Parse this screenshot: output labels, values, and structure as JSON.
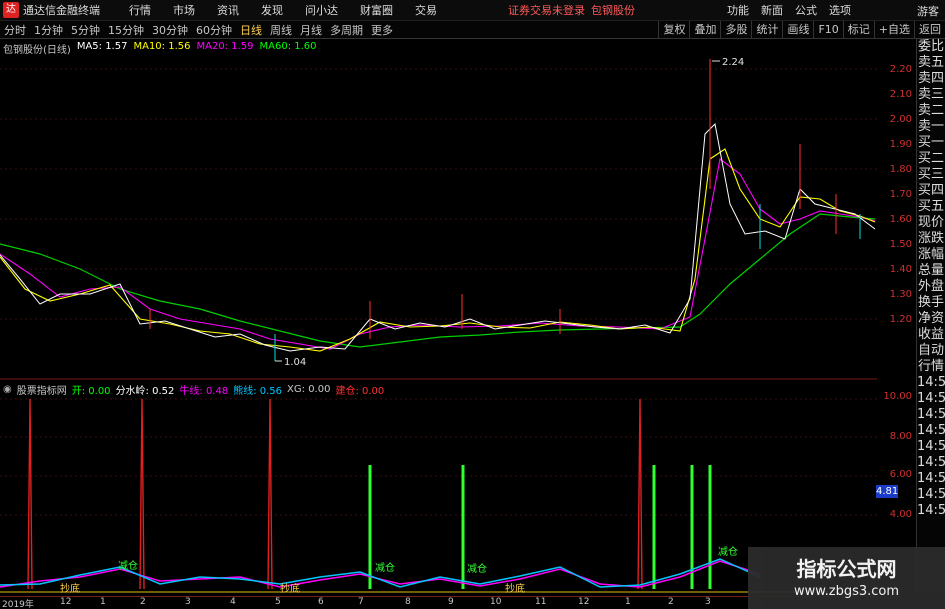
{
  "titlebar": {
    "app_title": "通达信金融终端",
    "menu": [
      "行情",
      "市场",
      "资讯",
      "发现",
      "问小达",
      "财富圈",
      "交易"
    ],
    "notice": "证券交易未登录",
    "notice_stock": "包钢股份",
    "right_menu": [
      "功能",
      "新面",
      "公式",
      "选项"
    ],
    "user": "游客"
  },
  "toolbar": {
    "periods": [
      "分时",
      "1分钟",
      "5分钟",
      "15分钟",
      "30分钟",
      "60分钟",
      "日线",
      "周线",
      "月线",
      "多周期",
      "更多"
    ],
    "active_period": "日线",
    "right_buttons": [
      "复权",
      "叠加",
      "多股",
      "统计",
      "画线",
      "F10",
      "标记",
      "+自选",
      "返回"
    ]
  },
  "main_chart": {
    "title": "包钢股份(日线)",
    "ma5": "MA5: 1.57",
    "ma10": "MA10: 1.56",
    "ma20": "MA20: 1.59",
    "ma60": "MA60: 1.60",
    "high_label": "2.24",
    "low_label": "1.04",
    "colors": {
      "ma5": "#ffffff",
      "ma10": "#ffff00",
      "ma20": "#ff00ff",
      "ma60": "#00ff00",
      "up": "#ff3030",
      "down": "#00e0e0"
    }
  },
  "sub_chart": {
    "title": "股票指标网",
    "l_kai": "开: 0.00",
    "l_fsl": "分水岭: 0.52",
    "l_nx": "牛线: 0.48",
    "l_xx": "熊线: 0.56",
    "l_xg": "XG: 0.00",
    "l_jc": "建仓: 0.00",
    "current_value": "4.81",
    "markers": [
      "减仓",
      "减仓",
      "抄底",
      "抄底",
      "减仓",
      "减仓",
      "抄底"
    ]
  },
  "price_axis": [
    "2.20",
    "2.10",
    "2.00",
    "1.90",
    "1.80",
    "1.70",
    "1.60",
    "1.50",
    "1.40",
    "1.30",
    "1.20"
  ],
  "sub_axis": [
    "10.00",
    "8.00",
    "6.00",
    "4.00"
  ],
  "side_panel": [
    "委比",
    "卖五",
    "卖四",
    "卖三",
    "卖二",
    "卖一",
    "买一",
    "买二",
    "买三",
    "买四",
    "买五",
    "现价",
    "涨跌",
    "涨幅",
    "总量",
    "外盘",
    "换手",
    "净资",
    "收益",
    "自动",
    "行情",
    "14:50",
    "14:50",
    "14:50",
    "14:50",
    "14:50",
    "14:50",
    "14:50",
    "14:50",
    "14:50"
  ],
  "date_axis": [
    "2019年",
    "12",
    "1",
    "2",
    "3",
    "4",
    "5",
    "6",
    "7",
    "8",
    "9",
    "10",
    "11",
    "12",
    "1",
    "2",
    "3"
  ],
  "watermark": {
    "line1": "指标公式网",
    "line2": "www.zbgs3.com"
  }
}
